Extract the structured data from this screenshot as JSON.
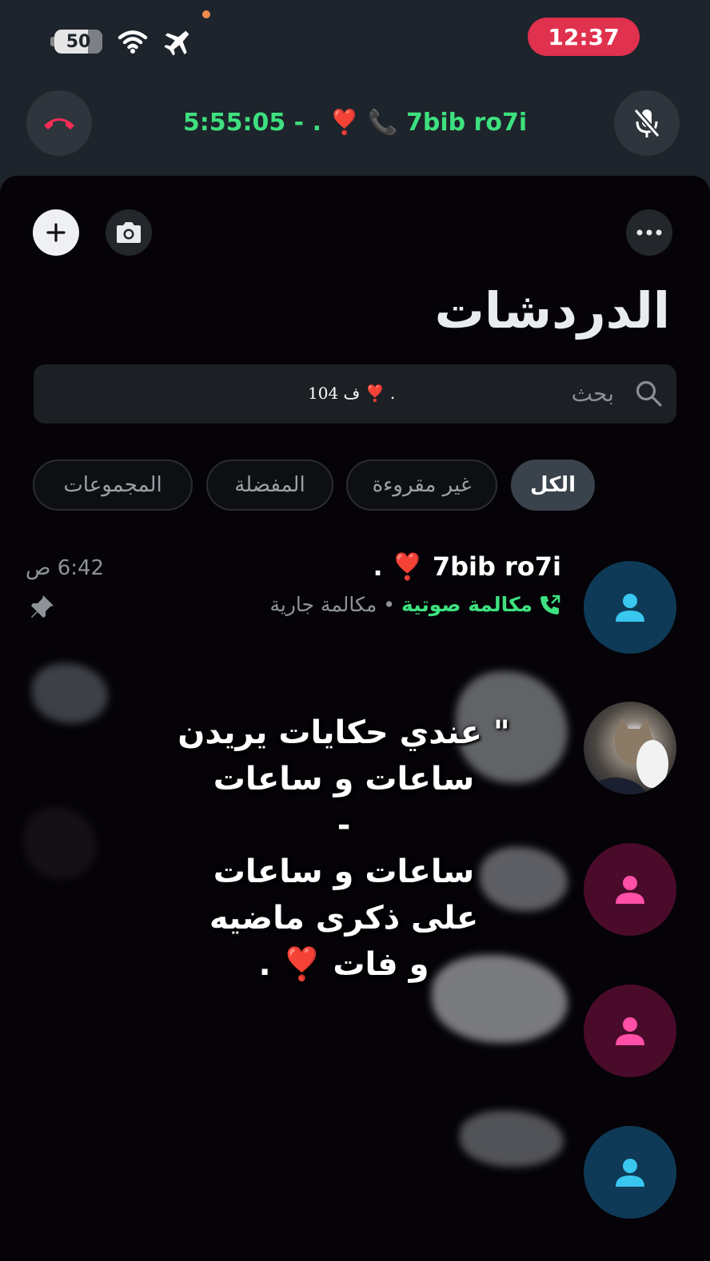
{
  "status_bar": {
    "battery": "50",
    "time": "12:37",
    "icons": [
      "wifi-icon",
      "airplane-icon"
    ]
  },
  "call_bar": {
    "text": "5:55:05 - . ❣️ 📞 7bib ro7i",
    "end_call_icon": "phone-hangup-icon",
    "mute_icon": "mic-off-icon",
    "accent": "#3ee07f"
  },
  "header": {
    "title": "الدردشات",
    "add_icon": "plus-icon",
    "camera_icon": "camera-icon",
    "more_icon": "ellipsis-icon"
  },
  "search": {
    "placeholder": "بحث",
    "value": "ف 104 ❣️ ."
  },
  "filters": {
    "tabs": [
      {
        "label": "الكل",
        "active": true
      },
      {
        "label": "غير مقروءة",
        "active": false
      },
      {
        "label": "المفضلة",
        "active": false
      },
      {
        "label": "المجموعات",
        "active": false
      }
    ]
  },
  "chats": [
    {
      "name": ". ❣️ 7bib ro7i",
      "time": "6:42 ص",
      "status_label": "مكالمة صوتية",
      "status_detail": "مكالمة جارية",
      "pinned": true,
      "avatar_color": "#0f3a57",
      "icon_color": "#39c7f0"
    },
    {
      "avatar_type": "photo"
    },
    {
      "avatar_color": "#4a0b2a",
      "icon_color": "#ff4fa6"
    },
    {
      "avatar_color": "#4a0b2a",
      "icon_color": "#ff4fa6"
    },
    {
      "avatar_color": "#0f3a57",
      "icon_color": "#39c7f0"
    }
  ],
  "overlay_lyrics": [
    "\" عندي حكايات يريدن",
    "ساعات و ساعات",
    "-",
    "ساعات و ساعات",
    "على ذكرى ماضيه",
    "و فات ❣️ ."
  ]
}
